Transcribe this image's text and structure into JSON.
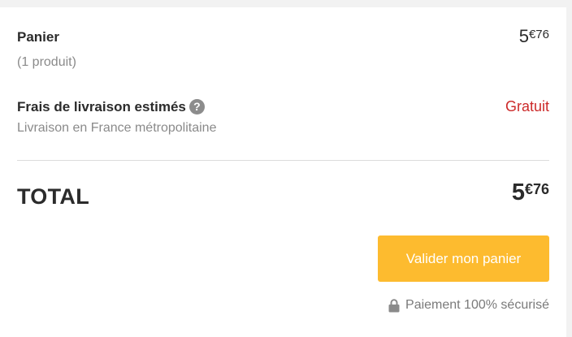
{
  "cart": {
    "label": "Panier",
    "count_text": "(1 produit)",
    "price_int": "5",
    "price_dec": "€76"
  },
  "shipping": {
    "label": "Frais de livraison estimés",
    "help_glyph": "?",
    "sub_text": "Livraison en France métropolitaine",
    "value": "Gratuit",
    "value_color": "#cc2a2a"
  },
  "total": {
    "label": "TOTAL",
    "price_int": "5",
    "price_dec": "€76"
  },
  "cta": {
    "label": "Valider mon panier",
    "color": "#fdbb2f"
  },
  "secure": {
    "icon": "lock-icon",
    "text": "Paiement 100% sécurisé"
  }
}
